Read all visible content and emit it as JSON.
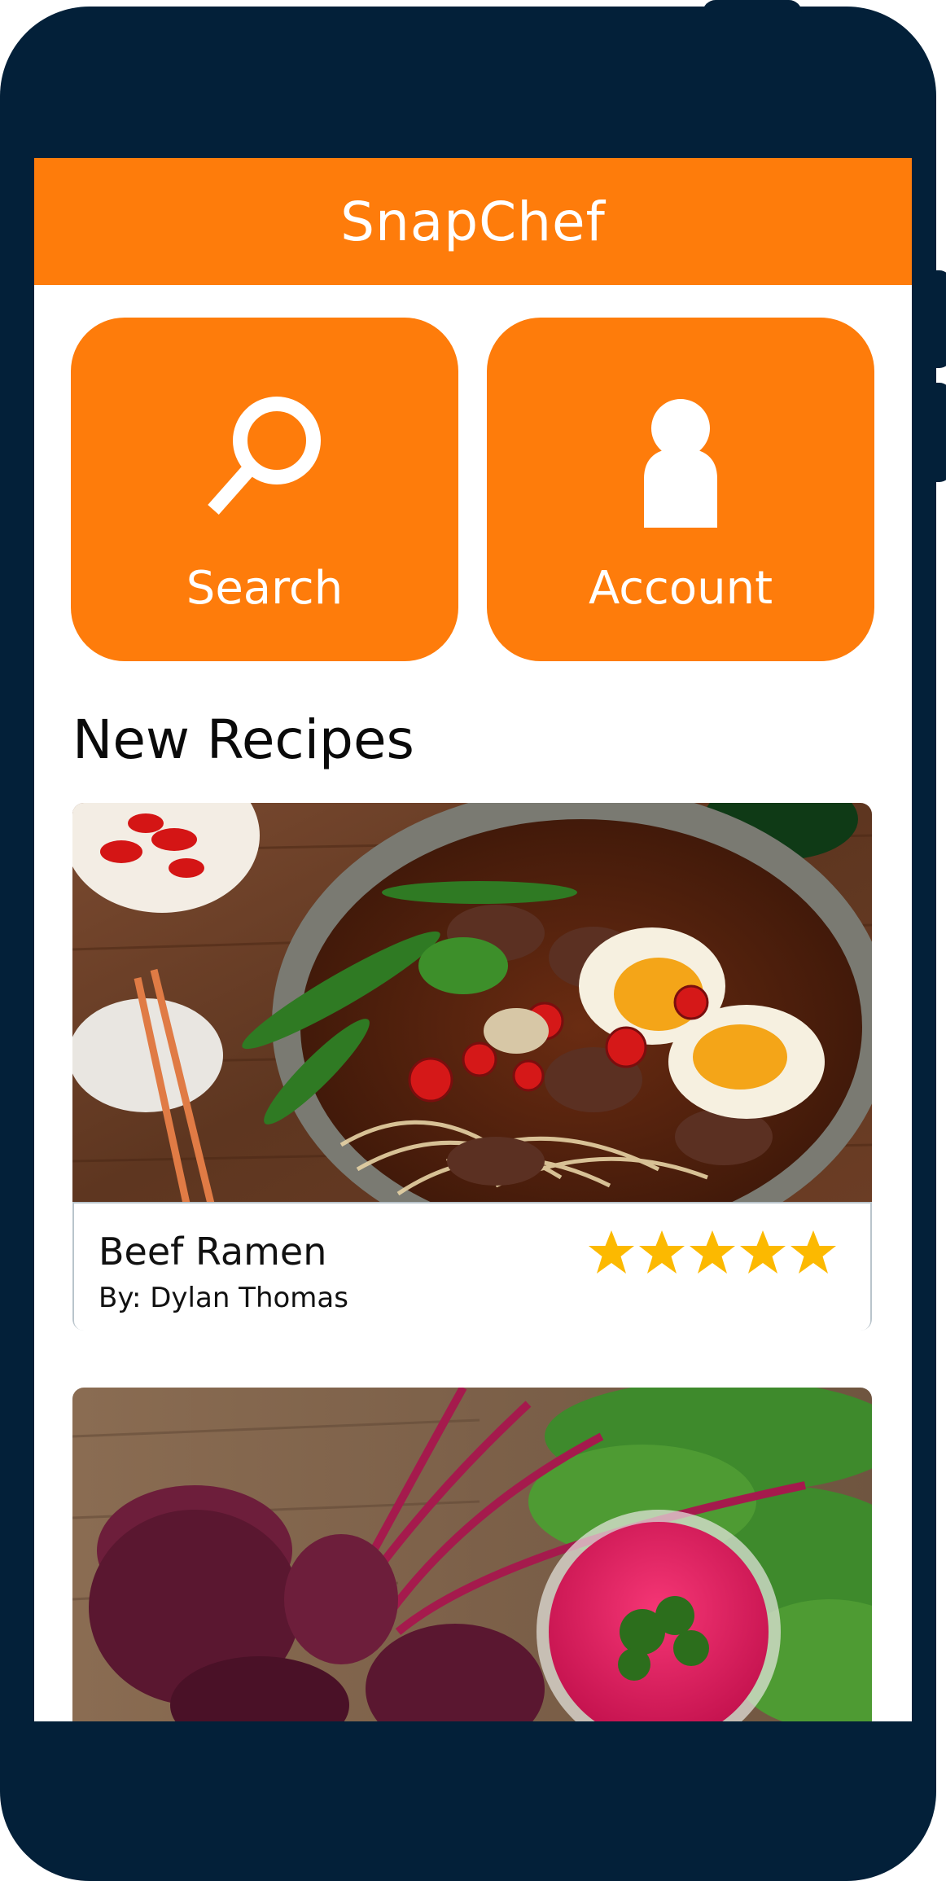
{
  "app": {
    "title": "SnapChef"
  },
  "tiles": [
    {
      "label": "Search",
      "icon": "search-icon"
    },
    {
      "label": "Account",
      "icon": "person-icon"
    }
  ],
  "section": {
    "title": "New Recipes"
  },
  "recipes": [
    {
      "name": "Beef Ramen",
      "author": "By: Dylan Thomas",
      "rating": 5,
      "rating_max": 5
    }
  ],
  "colors": {
    "accent": "#fe7c0b",
    "phone_frame": "#032039",
    "star": "#fcb900"
  }
}
